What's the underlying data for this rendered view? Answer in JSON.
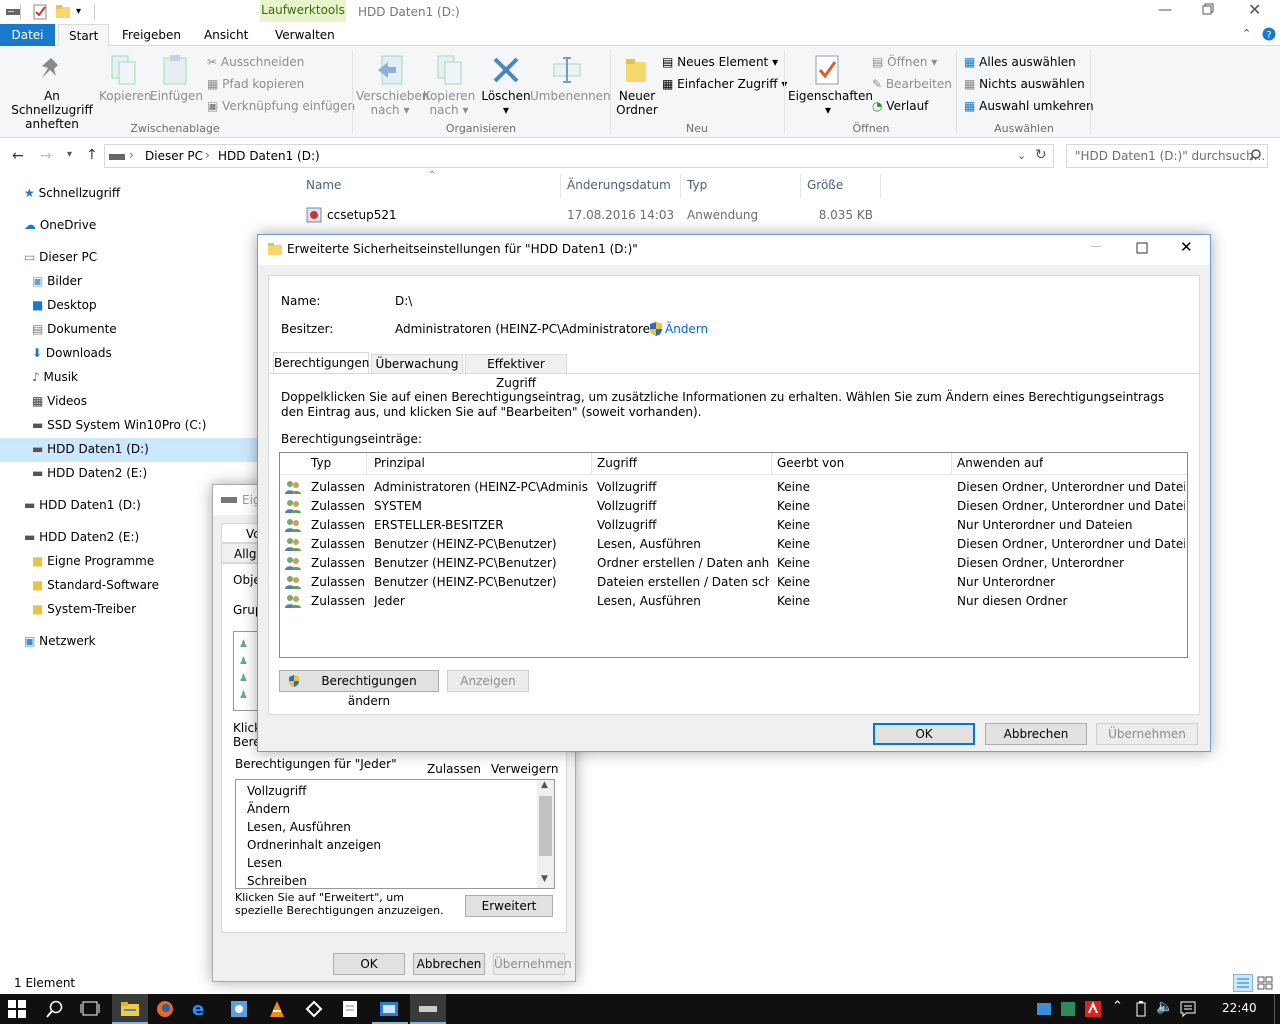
{
  "titlebar": {
    "title": "HDD Daten1 (D:)",
    "context_tab": "Laufwerktools"
  },
  "ribbon_tabs": [
    "Datei",
    "Start",
    "Freigeben",
    "Ansicht",
    "Verwalten"
  ],
  "ribbon": {
    "pin": "An Schnellzugriff anheften",
    "copy": "Kopieren",
    "paste": "Einfügen",
    "cut": "Ausschneiden",
    "copy_path": "Pfad kopieren",
    "paste_shortcut": "Verknüpfung einfügen",
    "group_clipboard": "Zwischenablage",
    "move_to": "Verschieben nach",
    "copy_to": "Kopieren nach",
    "delete": "Löschen",
    "rename": "Umbenennen",
    "group_organize": "Organisieren",
    "new_folder": "Neuer Ordner",
    "new_item": "Neues Element",
    "easy_access": "Einfacher Zugriff",
    "group_new": "Neu",
    "properties": "Eigenschaften",
    "open": "Öffnen",
    "edit": "Bearbeiten",
    "history": "Verlauf",
    "group_open": "Öffnen",
    "select_all": "Alles auswählen",
    "select_none": "Nichts auswählen",
    "invert_selection": "Auswahl umkehren",
    "group_select": "Auswählen"
  },
  "address": {
    "crumb1": "Dieser PC",
    "crumb2": "HDD Daten1 (D:)",
    "search_placeholder": "\"HDD Daten1 (D:)\" durchsuch..."
  },
  "nav": {
    "quick_access": "Schnellzugriff",
    "onedrive": "OneDrive",
    "this_pc": "Dieser PC",
    "pictures": "Bilder",
    "desktop": "Desktop",
    "documents": "Dokumente",
    "downloads": "Downloads",
    "music": "Musik",
    "videos": "Videos",
    "ssd": "SSD System Win10Pro (C:)",
    "hdd1": "HDD Daten1 (D:)",
    "hdd2": "HDD Daten2 (E:)",
    "hdd1b": "HDD Daten1 (D:)",
    "hdd2b": "HDD Daten2 (E:)",
    "f1": "Eigne Programme",
    "f2": "Standard-Software",
    "f3": "System-Treiber",
    "network": "Netzwerk"
  },
  "files": {
    "col_name": "Name",
    "col_date": "Änderungsdatum",
    "col_type": "Typ",
    "col_size": "Größe",
    "rows": [
      {
        "name": "ccsetup521",
        "date": "17.08.2016 14:03",
        "type": "Anwendung",
        "size": "8.035 KB"
      }
    ]
  },
  "status": {
    "count": "1 Element"
  },
  "props": {
    "title": "Eig",
    "tab1": "Vo",
    "tab2": "Allge",
    "obj": "Obje",
    "grp": "Grup",
    "click1": "Klick",
    "click2": "Bere",
    "perm_for": "Berechtigungen für \"Jeder\"",
    "allow": "Zulassen",
    "deny": "Verweigern",
    "perms": [
      "Vollzugriff",
      "Ändern",
      "Lesen, Ausführen",
      "Ordnerinhalt anzeigen",
      "Lesen",
      "Schreiben"
    ],
    "advanced_hint": "Klicken Sie auf \"Erweitert\", um spezielle Berechtigungen anzuzeigen.",
    "advanced": "Erweitert",
    "ok": "OK",
    "cancel": "Abbrechen",
    "apply": "Übernehmen"
  },
  "adv": {
    "title": "Erweiterte Sicherheitseinstellungen für \"HDD Daten1 (D:)\"",
    "name_label": "Name:",
    "name_value": "D:\\",
    "owner_label": "Besitzer:",
    "owner_value": "Administratoren (HEINZ-PC\\Administratoren)",
    "change": "Ändern",
    "tabs": [
      "Berechtigungen",
      "Überwachung",
      "Effektiver Zugriff"
    ],
    "info": "Doppelklicken Sie auf einen Berechtigungseintrag, um zusätzliche Informationen zu erhalten. Wählen Sie zum Ändern eines Berechtigungseintrags den Eintrag aus, und klicken Sie auf \"Bearbeiten\" (soweit vorhanden).",
    "entries_label": "Berechtigungseinträge:",
    "cols": [
      "Typ",
      "Prinzipal",
      "Zugriff",
      "Geerbt von",
      "Anwenden auf"
    ],
    "rows": [
      [
        "Zulassen",
        "Administratoren (HEINZ-PC\\Administ...",
        "Vollzugriff",
        "Keine",
        "Diesen Ordner, Unterordner und Dateien"
      ],
      [
        "Zulassen",
        "SYSTEM",
        "Vollzugriff",
        "Keine",
        "Diesen Ordner, Unterordner und Dateien"
      ],
      [
        "Zulassen",
        "ERSTELLER-BESITZER",
        "Vollzugriff",
        "Keine",
        "Nur Unterordner und Dateien"
      ],
      [
        "Zulassen",
        "Benutzer (HEINZ-PC\\Benutzer)",
        "Lesen, Ausführen",
        "Keine",
        "Diesen Ordner, Unterordner und Dateien"
      ],
      [
        "Zulassen",
        "Benutzer (HEINZ-PC\\Benutzer)",
        "Ordner erstellen / Daten anhä...",
        "Keine",
        "Diesen Ordner, Unterordner"
      ],
      [
        "Zulassen",
        "Benutzer (HEINZ-PC\\Benutzer)",
        "Dateien erstellen / Daten schr...",
        "Keine",
        "Nur Unterordner"
      ],
      [
        "Zulassen",
        "Jeder",
        "Lesen, Ausführen",
        "Keine",
        "Nur diesen Ordner"
      ]
    ],
    "change_perms": "Berechtigungen ändern",
    "view": "Anzeigen",
    "ok": "OK",
    "cancel": "Abbrechen",
    "apply": "Übernehmen"
  },
  "taskbar": {
    "clock": "22:40"
  },
  "colors": {
    "accent": "#0078d7",
    "file_tab": "#1979ca",
    "selected_nav": "#cce8ff"
  }
}
